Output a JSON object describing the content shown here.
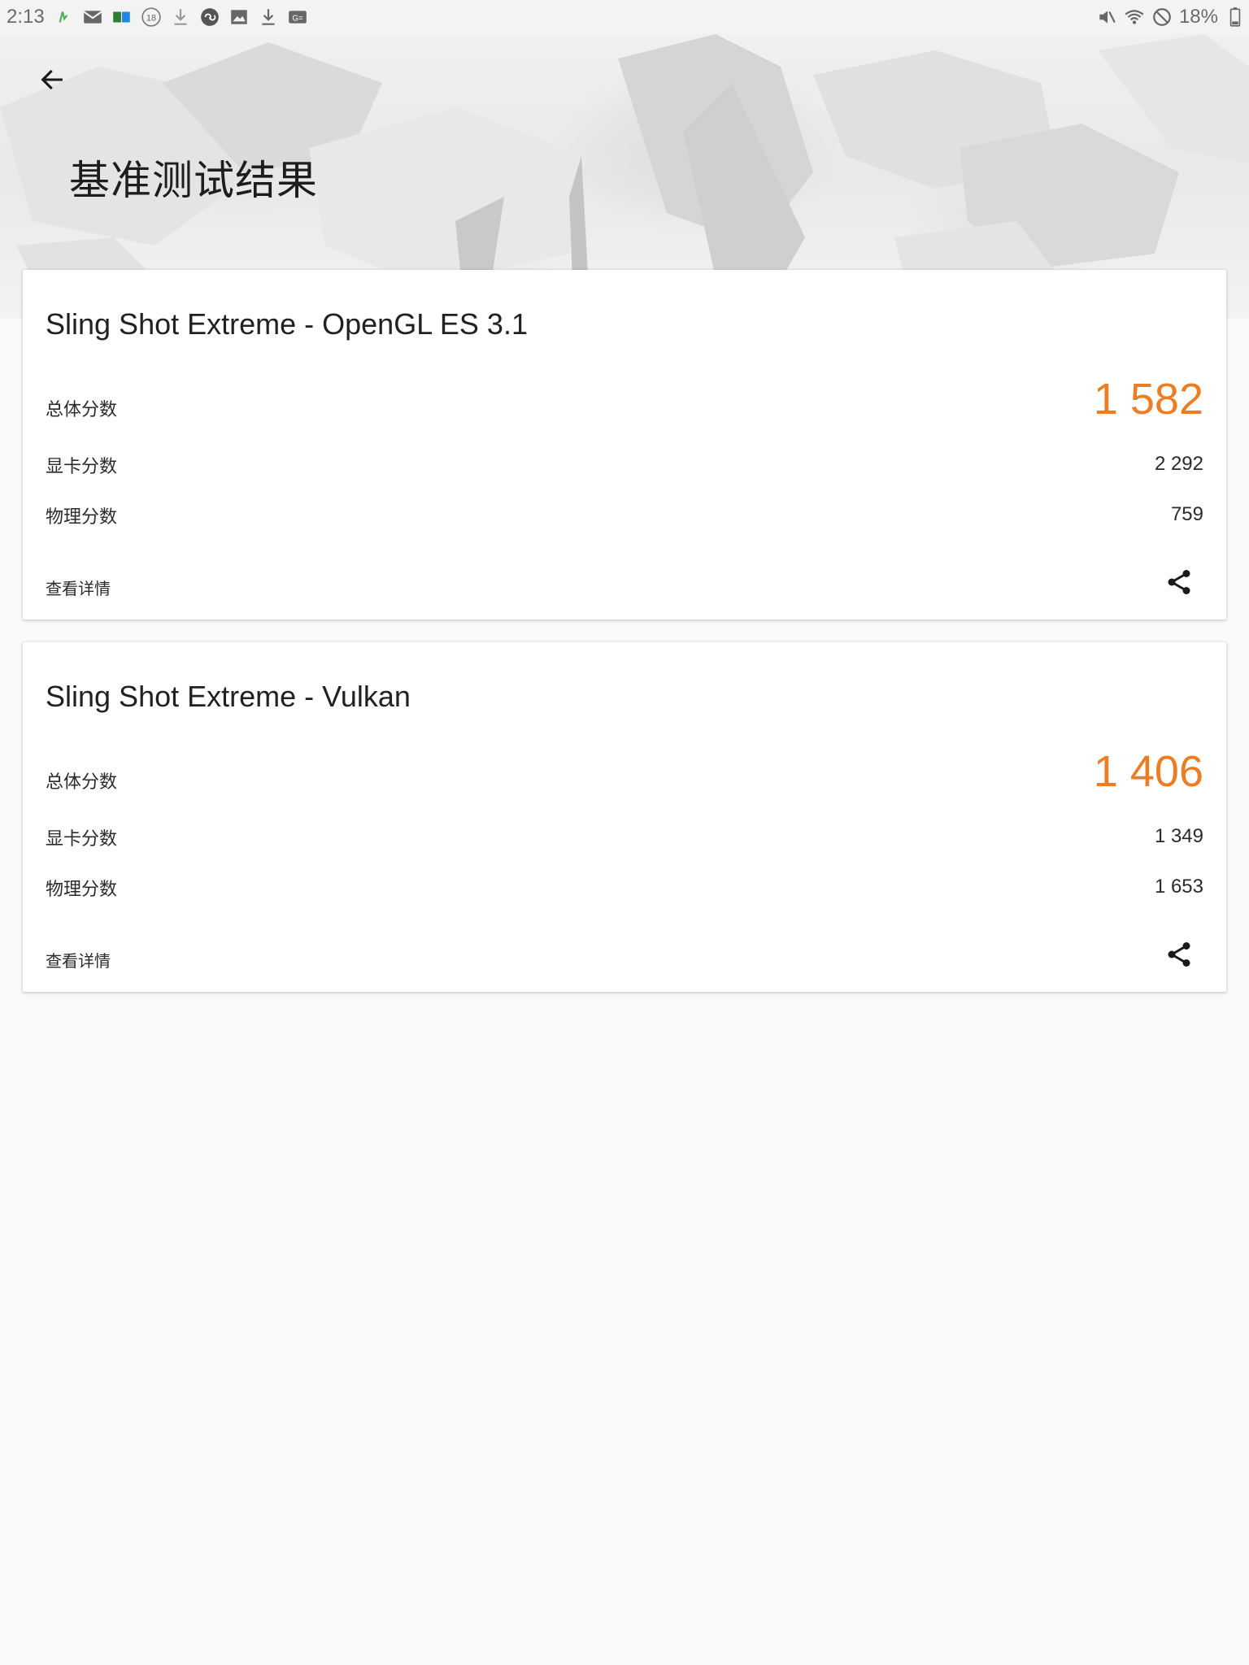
{
  "status_bar": {
    "time": "2:13",
    "battery": "18%",
    "left_icons": [
      "activity-icon",
      "mail-icon",
      "books-icon",
      "badge-18-icon",
      "download-icon",
      "sync-icon",
      "image-icon",
      "download-icon",
      "card-icon"
    ],
    "right_icons": [
      "mute-icon",
      "wifi-icon",
      "no-disturb-icon",
      "battery-icon"
    ]
  },
  "header": {
    "title": "基准测试结果",
    "back_icon": "arrow-back-icon"
  },
  "results": [
    {
      "title": "Sling Shot Extreme - OpenGL ES 3.1",
      "overall_label": "总体分数",
      "overall_score": "1 582",
      "graphics_label": "显卡分数",
      "graphics_score": "2 292",
      "physics_label": "物理分数",
      "physics_score": "759",
      "details_label": "查看详情",
      "share_icon": "share-icon"
    },
    {
      "title": "Sling Shot Extreme - Vulkan",
      "overall_label": "总体分数",
      "overall_score": "1 406",
      "graphics_label": "显卡分数",
      "graphics_score": "1 349",
      "physics_label": "物理分数",
      "physics_score": "1 653",
      "details_label": "查看详情",
      "share_icon": "share-icon"
    }
  ],
  "colors": {
    "accent_score": "#ec7d22",
    "background": "#f9f9f9",
    "card": "#ffffff"
  }
}
